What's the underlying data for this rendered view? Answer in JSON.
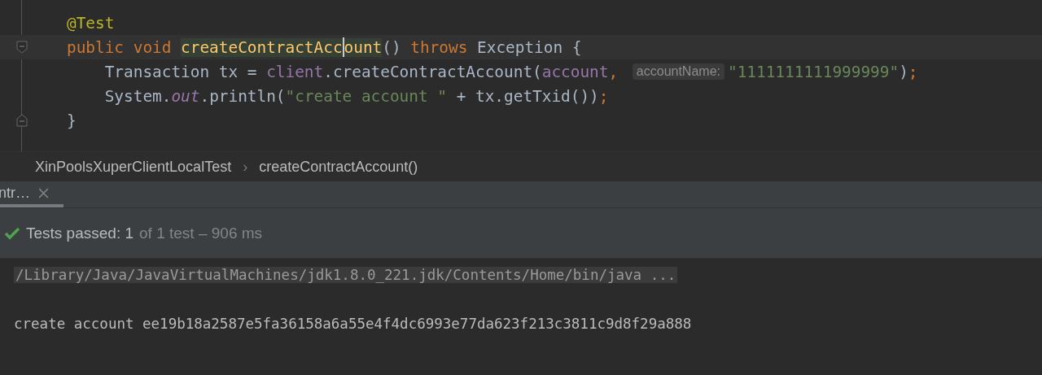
{
  "editor": {
    "lines": [
      {
        "current": false,
        "fold_start": false,
        "fold_end": false,
        "tokens": [
          {
            "text": "@Test",
            "kind": "annotation",
            "caret": false
          }
        ]
      },
      {
        "current": true,
        "fold_start": true,
        "fold_end": false,
        "tokens": [
          {
            "text": "public void ",
            "kind": "keyword",
            "caret": false
          },
          {
            "text": "createContractAcc",
            "kind": "decl",
            "caret": true
          },
          {
            "text": "ount",
            "kind": "decl",
            "caret": false
          },
          {
            "text": "() ",
            "kind": "plain",
            "caret": false
          },
          {
            "text": "throws ",
            "kind": "keyword",
            "caret": false
          },
          {
            "text": "Exception {",
            "kind": "plain",
            "caret": false
          }
        ]
      },
      {
        "current": false,
        "fold_start": false,
        "fold_end": false,
        "tokens": [
          {
            "text": "    Transaction tx = ",
            "kind": "plain",
            "caret": false
          },
          {
            "text": "client",
            "kind": "field",
            "caret": false
          },
          {
            "text": ".createContractAccount(",
            "kind": "plain",
            "caret": false
          },
          {
            "text": "account",
            "kind": "field",
            "caret": false
          },
          {
            "text": ", ",
            "kind": "punct",
            "caret": false
          },
          {
            "text": "accountName:",
            "kind": "hint",
            "caret": false
          },
          {
            "text": "\"1111111111999999\"",
            "kind": "string",
            "caret": false
          },
          {
            "text": ")",
            "kind": "plain",
            "caret": false
          },
          {
            "text": ";",
            "kind": "punct",
            "caret": false
          }
        ]
      },
      {
        "current": false,
        "fold_start": false,
        "fold_end": false,
        "tokens": [
          {
            "text": "    System.",
            "kind": "plain",
            "caret": false
          },
          {
            "text": "out",
            "kind": "static",
            "caret": false
          },
          {
            "text": ".println(",
            "kind": "plain",
            "caret": false
          },
          {
            "text": "\"create account \"",
            "kind": "string",
            "caret": false
          },
          {
            "text": " + tx.getTxid())",
            "kind": "plain",
            "caret": false
          },
          {
            "text": ";",
            "kind": "punct",
            "caret": false
          }
        ]
      },
      {
        "current": false,
        "fold_start": false,
        "fold_end": true,
        "tokens": [
          {
            "text": "}",
            "kind": "plain",
            "caret": false
          }
        ]
      }
    ]
  },
  "breadcrumbs": {
    "items": [
      "XinPoolsXuperClientLocalTest",
      "createContractAccount()"
    ],
    "separator": "›"
  },
  "run_tabs": [
    {
      "label": "ntr…",
      "selected": true
    }
  ],
  "test_status": {
    "passed": "Tests passed: 1",
    "detail": "of 1 test – 906 ms"
  },
  "console": [
    {
      "text": "/Library/Java/JavaVirtualMachines/jdk1.8.0_221.jdk/Contents/Home/bin/java ...",
      "kind": "command"
    },
    {
      "text": "create account ee19b18a2587e5fa36158a6a55e4f4dc6993e77da623f213c3811c9d8f29a888",
      "kind": "output"
    }
  ]
}
